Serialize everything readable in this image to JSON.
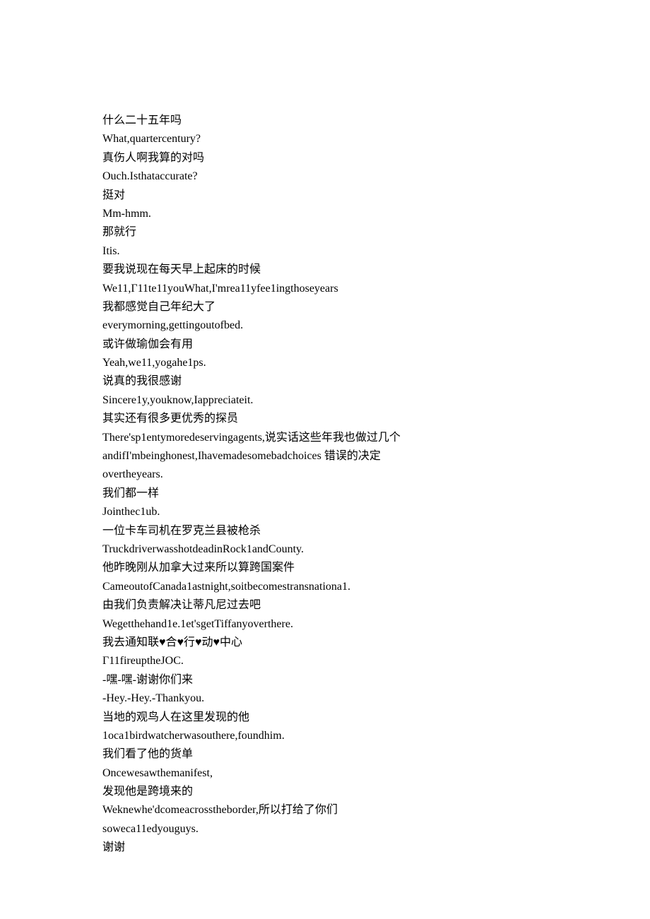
{
  "lines": [
    "什么二十五年吗",
    "What,quartercentury?",
    "真伤人啊我算的对吗",
    "Ouch.Isthataccurate?",
    "挺对",
    "Mm-hmm.",
    "那就行",
    "Itis.",
    "要我说现在每天早上起床的时候",
    "We11,Г11te11youWhat,I'mrea11yfee1ingthoseyears",
    "我都感觉自己年纪大了",
    "everymorning,gettingoutofbed.",
    "或许做瑜伽会有用",
    "Yeah,we11,yogahe1ps.",
    "说真的我很感谢",
    "Sincere1y,youknow,Iappreciateit.",
    "其实还有很多更优秀的探员",
    "There'sp1entymoredeservingagents,说实话这些年我也做过几个",
    "andifI'mbeinghonest,Ihavemadesomebadchoices 错误的决定",
    "overtheyears.",
    "我们都一样",
    "Jointhec1ub.",
    "一位卡车司机在罗克兰县被枪杀",
    "TruckdriverwasshotdeadinRock1andCounty.",
    "他昨晚刚从加拿大过来所以算跨国案件",
    "CameoutofCanada1astnight,soitbecomestransnationa1.",
    "由我们负责解决让蒂凡尼过去吧",
    "Wegetthehand1e.1et'sgetTiffanyoverthere.",
    "我去通知联♥合♥行♥动♥中心",
    "Г11fireuptheJOC.",
    "-嘿-嘿-谢谢你们来",
    "-Hey.-Hey.-Thankyou.",
    "当地的观鸟人在这里发现的他",
    "1oca1birdwatcherwasouthere,foundhim.",
    "我们看了他的货单",
    "Oncewesawthemanifest,",
    "发现他是跨境来的",
    "Weknewhe'dcomeacrosstheborder,所以打给了你们",
    "soweca11edyouguys.",
    "谢谢"
  ]
}
